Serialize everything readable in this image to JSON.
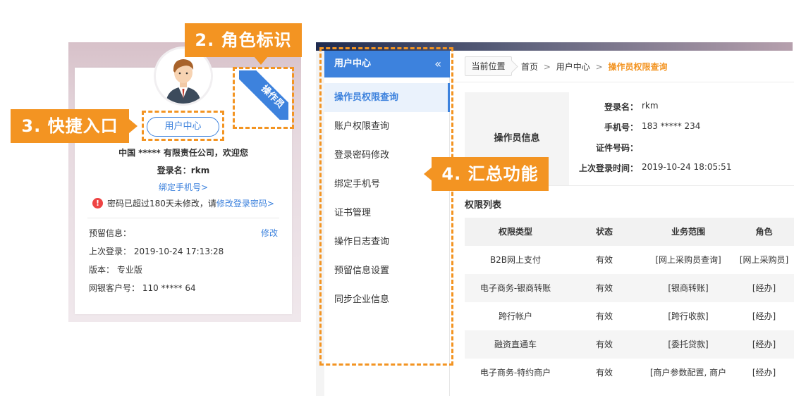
{
  "callouts": {
    "role": "2. 角色标识",
    "quick": "3. 快捷入口",
    "summary": "4. 汇总功能"
  },
  "profile": {
    "role_badge": "操作员",
    "user_center_button": "用户中心",
    "company": "中国 ***** 有限责任公司，欢迎您",
    "login_name": "登录名：rkm",
    "bind_phone": "绑定手机号>",
    "pwd_warning_prefix": "密码已超过180天未修改，请",
    "pwd_warning_link": "修改登录密码>",
    "reserved_label": "预留信息：",
    "edit_link": "修改",
    "last_login": "上次登录： 2019-10-24 17:13:28",
    "version": "版本： 专业版",
    "customer_no": "网银客户号： 110 ***** 64"
  },
  "sidebar": {
    "title": "用户中心",
    "collapse_icon": "«",
    "items": [
      {
        "label": "操作员权限查询",
        "active": true
      },
      {
        "label": "账户权限查询"
      },
      {
        "label": "登录密码修改"
      },
      {
        "label": "绑定手机号"
      },
      {
        "label": "证书管理"
      },
      {
        "label": "操作日志查询"
      },
      {
        "label": "预留信息设置"
      },
      {
        "label": "同步企业信息"
      }
    ]
  },
  "breadcrumb": {
    "tag": "当前位置",
    "home": "首页",
    "sep": ">",
    "middle": "用户中心",
    "current": "操作员权限查询"
  },
  "operator": {
    "section_label": "操作员信息",
    "fields": [
      {
        "key": "登录名：",
        "value": "rkm"
      },
      {
        "key": "手机号：",
        "value": "183 ***** 234"
      },
      {
        "key": "证件号码：",
        "value": ""
      },
      {
        "key": "上次登录时间：",
        "value": "2019-10-24 18:05:51"
      }
    ]
  },
  "permissions": {
    "title": "权限列表",
    "headers": [
      "权限类型",
      "状态",
      "业务范围",
      "角色"
    ],
    "rows": [
      [
        "B2B网上支付",
        "有效",
        "[网上采购员查询]",
        "[网上采购员]"
      ],
      [
        "电子商务-银商转账",
        "有效",
        "[银商转账]",
        "[经办]"
      ],
      [
        "跨行帐户",
        "有效",
        "[跨行收款]",
        "[经办]"
      ],
      [
        "融资直通车",
        "有效",
        "[委托贷款]",
        "[经办]"
      ],
      [
        "电子商务-特约商户",
        "有效",
        "[商户参数配置, 商户",
        "[经办]"
      ]
    ]
  },
  "colors": {
    "accent": "#3d82dd",
    "callout": "#f39422"
  }
}
